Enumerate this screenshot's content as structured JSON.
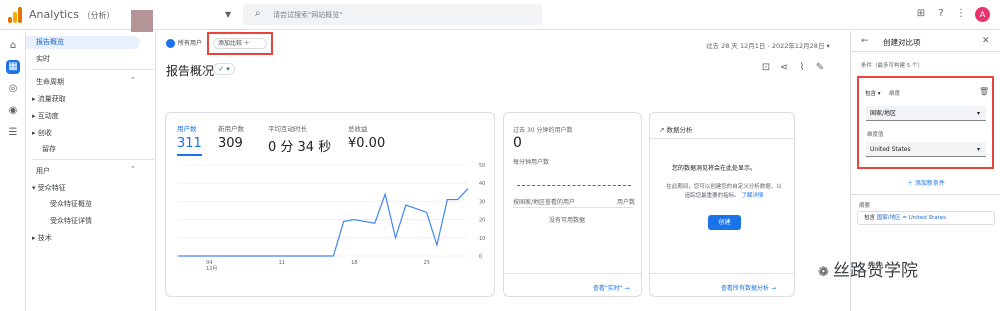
{
  "header": {
    "app_name": "Analytics",
    "account_label": "（分析）",
    "search_placeholder": "请尝试搜索\"网站概览\"",
    "avatar_letter": "A"
  },
  "colors": {
    "accent": "#1a73e8",
    "highlight": "#e8453c",
    "avatar": "#e8336b"
  },
  "rail_icons": [
    "home-icon",
    "reports-icon",
    "explore-icon",
    "advertising-icon",
    "configure-icon"
  ],
  "nav": {
    "report_overview": "报告概览",
    "realtime": "实时",
    "lifecycle": "生命周期",
    "acquisition": "流量获取",
    "engagement": "互动度",
    "monetization": "创收",
    "retention": "留存",
    "user": "用户",
    "demographics": "受众特征",
    "demographics_overview": "受众特征概览",
    "demographics_details": "受众特征详情",
    "tech": "技术"
  },
  "main": {
    "all_users_chip": "所有用户",
    "add_comparison": "添加比较 ＋",
    "date_range": "过去 28 天  12月1日 - 2022年12月28日 ▾",
    "page_title": "报告概况",
    "metrics": [
      {
        "label": "用户数",
        "value": "311"
      },
      {
        "label": "新用户数",
        "value": "309"
      },
      {
        "label": "平均互动时长",
        "value": "0 分 34 秒"
      },
      {
        "label": "总收益",
        "value": "¥0.00"
      }
    ]
  },
  "chart_data": {
    "type": "line",
    "x_tick_labels": [
      "04\n12月",
      "11",
      "18",
      "25"
    ],
    "y_ticks": [
      0,
      10,
      20,
      30,
      40,
      50
    ],
    "ylim": [
      0,
      50
    ],
    "series": [
      {
        "values": [
          0,
          0,
          0,
          0,
          0,
          0,
          0,
          0,
          0,
          0,
          0,
          0,
          0,
          0,
          0,
          0,
          19,
          20,
          19,
          18,
          34,
          10,
          28,
          26,
          24,
          6,
          31,
          31,
          37
        ]
      }
    ]
  },
  "realtime_card": {
    "title": "过去 30 分钟的用户数",
    "value": "0",
    "subtitle": "每分钟用户数",
    "col_country": "按国家/地区查看的用户",
    "col_users": "用户数",
    "no_data": "没有可用数据",
    "link": "查看\"实时\" →"
  },
  "insights_card": {
    "title": "数据分析",
    "heading": "您的数据洞见将会在此处显示。",
    "body": "在此期间，您可以创建您的自定义分析数据，以追踪您最重要的指标。",
    "learn_more": "了解详情",
    "create_btn": "创建",
    "link": "查看所有数据分析 →"
  },
  "panel": {
    "title": "创建对比项",
    "conditions_label": "条件（最多可构建 5 个）",
    "include": "包含 ▾",
    "dimension_label": "维度",
    "dimension_value": "国家/地区",
    "match_label": "维度值",
    "match_value": "United States",
    "add_condition": "＋  添加新条件",
    "summary_label": "摘要",
    "summary_include": "包含",
    "summary_text": "国家/地区 = United States"
  },
  "watermark": "丝路赞学院"
}
